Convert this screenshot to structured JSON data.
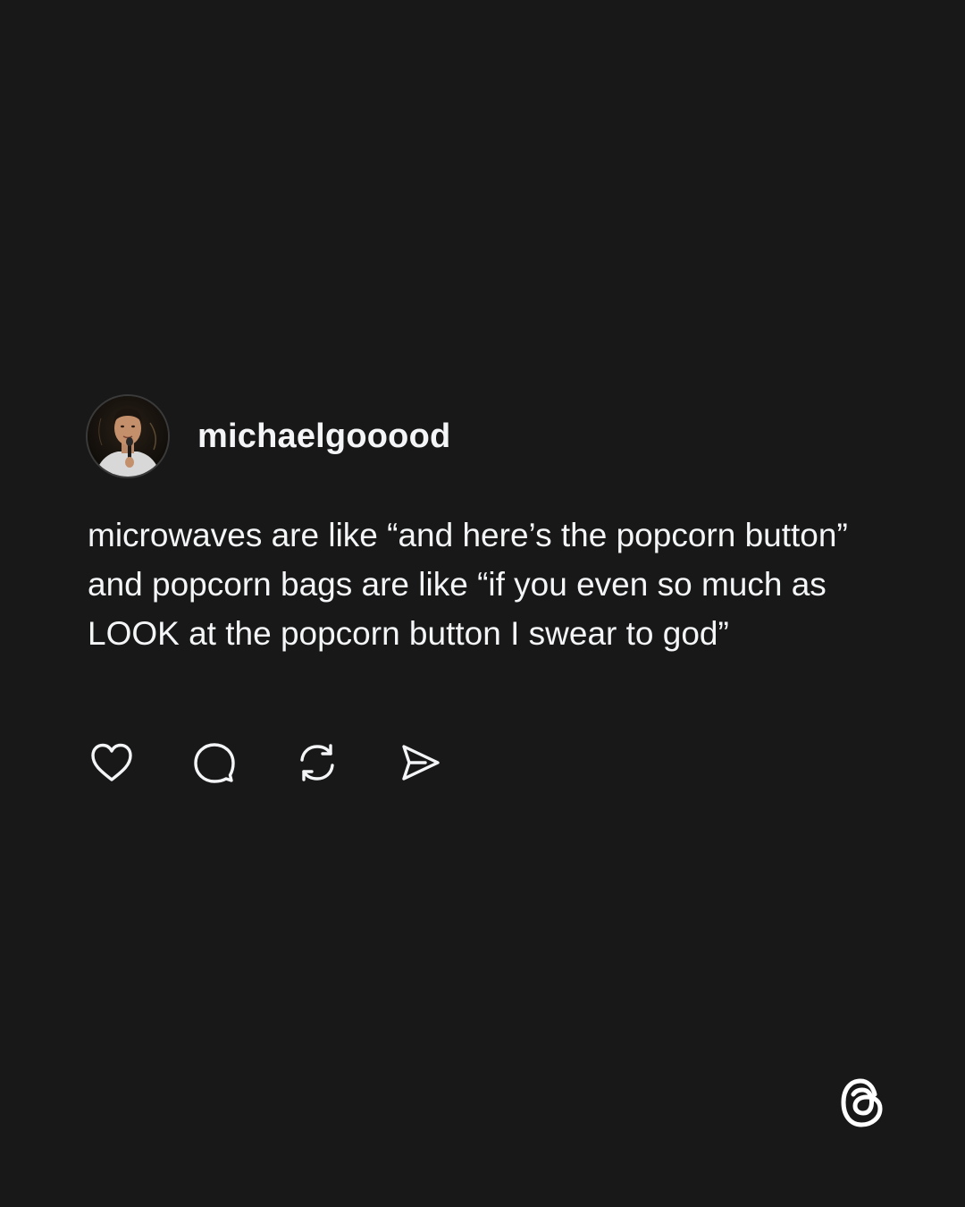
{
  "post": {
    "username": "michaelgooood",
    "text": "microwaves are like “and here’s the popcorn button” and popcorn bags are like “if you even so much as LOOK at the popcorn button I swear to god”",
    "avatar": "profile-photo"
  },
  "actions": [
    {
      "icon": "heart-icon"
    },
    {
      "icon": "comment-icon"
    },
    {
      "icon": "repost-icon"
    },
    {
      "icon": "share-icon"
    }
  ],
  "branding": {
    "logo": "threads-logo"
  },
  "colors": {
    "background": "#181818",
    "text": "#f3f5f7",
    "icon": "#f3f5f7"
  }
}
